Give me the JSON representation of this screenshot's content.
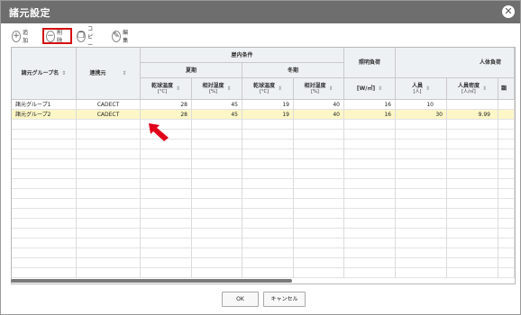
{
  "dialog": {
    "title": "諸元設定",
    "close_icon": "close-icon"
  },
  "toolbar": {
    "add_label": "追加",
    "delete_label": "削除",
    "copy_label": "コピー",
    "edit_label": "編集",
    "add_icon_glyph": "+",
    "delete_icon_glyph": "−",
    "copy_icon_glyph": "❐",
    "edit_icon_glyph": "✎"
  },
  "table": {
    "header_group": "諸元グループ名",
    "header_link": "連携元",
    "header_indoor": "屋内条件",
    "header_summer": "夏期",
    "header_winter": "冬期",
    "header_light": "照明負荷",
    "header_body": "人体負荷",
    "col_dry_temp": "乾球温度",
    "col_dry_temp_unit": "[°C]",
    "col_rel_hum": "相対湿度",
    "col_rel_hum_unit": "[%]",
    "col_light_unit": "[W/㎡]",
    "col_people": "人員",
    "col_people_unit": "[人]",
    "col_density": "人員密度",
    "col_density_unit": "[人/㎡]",
    "col_cut": "顕",
    "rows": [
      {
        "name": "諸元グループ1",
        "link": "CADECT",
        "s_temp": "28",
        "s_hum": "45",
        "w_temp": "19",
        "w_hum": "40",
        "light": "16",
        "people": "10",
        "density": ""
      },
      {
        "name": "諸元グループ2",
        "link": "CADECT",
        "s_temp": "28",
        "s_hum": "45",
        "w_temp": "19",
        "w_hum": "40",
        "light": "16",
        "people": "30",
        "density": "9.99"
      }
    ]
  },
  "footer": {
    "ok_label": "OK",
    "cancel_label": "キャンセル"
  },
  "colors": {
    "titlebar": "#6e6e6e",
    "highlight_box": "#d61111",
    "arrow": "#e0001a",
    "selected_row": "#fdf6c7"
  }
}
